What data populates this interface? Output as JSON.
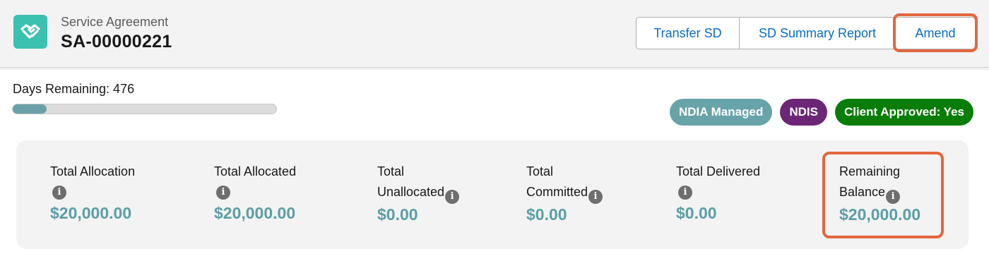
{
  "header": {
    "object_label": "Service Agreement",
    "record_name": "SA-00000221",
    "icon": "handshake-icon",
    "buttons": {
      "transfer": "Transfer SD",
      "summary": "SD Summary Report",
      "amend": "Amend"
    }
  },
  "progress": {
    "label": "Days Remaining: 476",
    "fill_fraction": 0.13
  },
  "badges": [
    {
      "label": "NDIA Managed",
      "color": "#68a3aa"
    },
    {
      "label": "NDIS",
      "color": "#6b2675"
    },
    {
      "label": "Client Approved: Yes",
      "color": "#0a7d08"
    }
  ],
  "stats": [
    {
      "label_line1": "Total Allocation",
      "label_line2": "",
      "value": "$20,000.00"
    },
    {
      "label_line1": "Total Allocated",
      "label_line2": "",
      "value": "$20,000.00"
    },
    {
      "label_line1": "Total",
      "label_line2": "Unallocated",
      "value": "$0.00"
    },
    {
      "label_line1": "Total",
      "label_line2": "Committed",
      "value": "$0.00"
    },
    {
      "label_line1": "Total Delivered",
      "label_line2": "",
      "value": "$0.00"
    },
    {
      "label_line1": "Remaining",
      "label_line2": "Balance",
      "value": "$20,000.00"
    }
  ],
  "colors": {
    "accent_link": "#0b6cc4",
    "value_teal": "#5b9ea6",
    "highlight": "#e2673f",
    "app_icon": "#3bc1b0"
  }
}
